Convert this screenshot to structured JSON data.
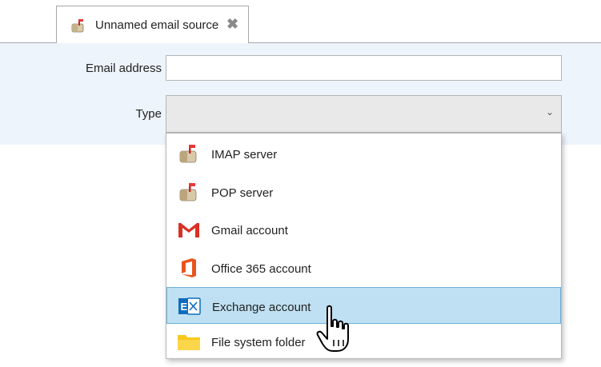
{
  "tab": {
    "title": "Unnamed email source",
    "close_icon": "close-icon"
  },
  "form": {
    "email_label": "Email address",
    "email_value": "",
    "type_label": "Type",
    "type_selected": ""
  },
  "dropdown": {
    "options": [
      {
        "label": "IMAP server",
        "icon": "mailbox-icon",
        "selected": false
      },
      {
        "label": "POP server",
        "icon": "mailbox-icon",
        "selected": false
      },
      {
        "label": "Gmail account",
        "icon": "gmail-icon",
        "selected": false
      },
      {
        "label": "Office 365 account",
        "icon": "office365-icon",
        "selected": false
      },
      {
        "label": "Exchange account",
        "icon": "exchange-icon",
        "selected": true
      },
      {
        "label": "File system folder",
        "icon": "folder-icon",
        "selected": false
      }
    ]
  },
  "colors": {
    "panel_bg": "#eef4fc",
    "selected_bg": "#bfe0f2",
    "selected_border": "#6fb0d6",
    "gmail_red": "#d93025",
    "office_orange": "#e8541e",
    "exchange_blue": "#0f6cbd",
    "folder_yellow": "#f8c81c"
  }
}
